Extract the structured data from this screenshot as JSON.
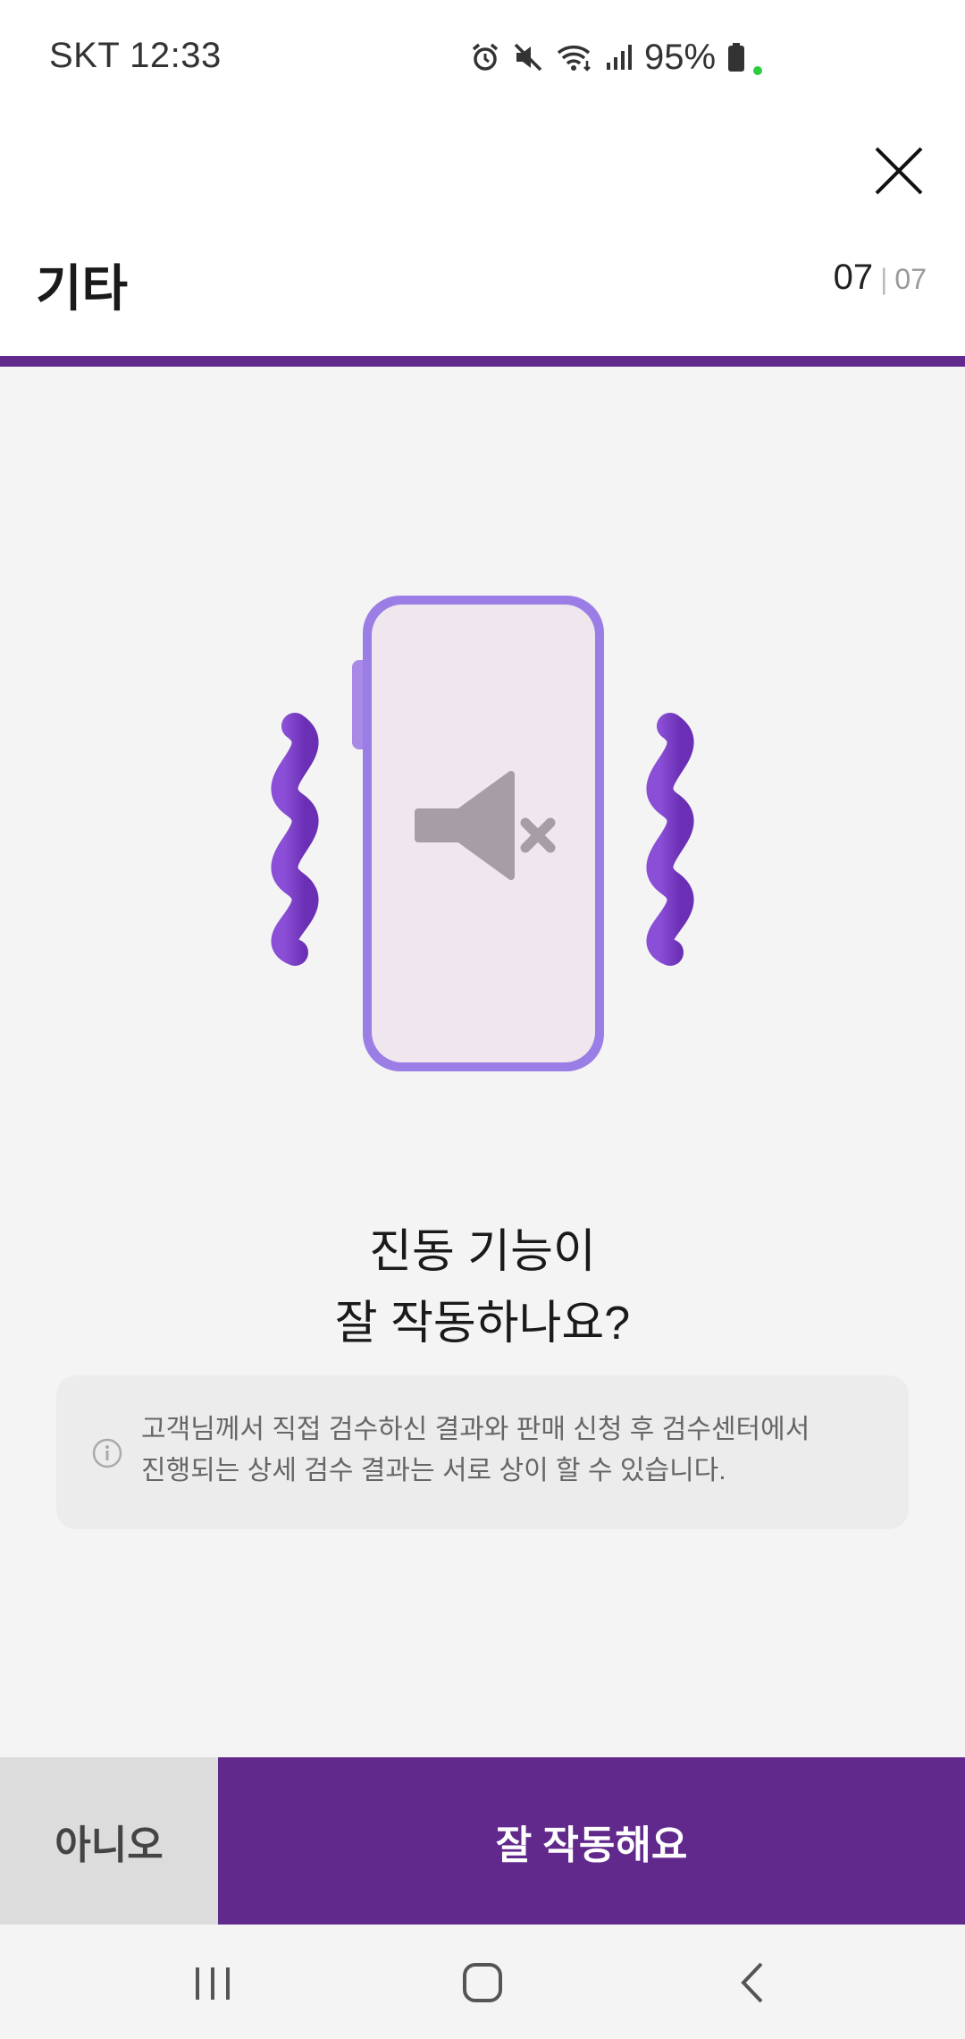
{
  "status_bar": {
    "carrier_time": "SKT 12:33",
    "battery": "95%",
    "icons": [
      "alarm-icon",
      "mute-icon",
      "wifi-icon",
      "signal-icon",
      "battery-icon"
    ]
  },
  "header": {
    "title": "기타",
    "step_current": "07",
    "step_separator": "|",
    "step_total": "07",
    "close_icon": "close-icon"
  },
  "progress": {
    "fraction": 1.0,
    "color": "#62298c"
  },
  "illustration": {
    "icon": "vibrating-muted-phone-icon"
  },
  "question": {
    "line1": "진동 기능이",
    "line2": "잘 작동하나요?"
  },
  "notice": {
    "icon": "info-icon",
    "text_line1": "고객님께서 직접 검수하신 결과와 판매 신청 후 검수센터에서",
    "text_line2": "진행되는 상세 검수 결과는 서로 상이 할 수 있습니다."
  },
  "buttons": {
    "no_label": "아니오",
    "yes_label": "잘 작동해요"
  },
  "nav": {
    "icons": [
      "recent-apps-icon",
      "home-icon",
      "back-icon"
    ]
  },
  "colors": {
    "accent": "#62298c",
    "wave": "#7b3fc4",
    "phone_border": "#9b7de6"
  }
}
